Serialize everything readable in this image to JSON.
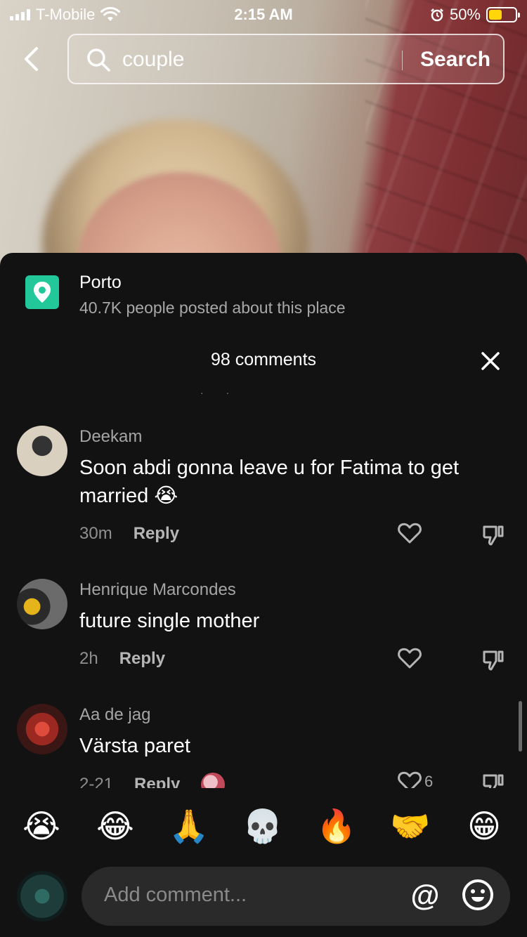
{
  "status_bar": {
    "carrier": "T-Mobile",
    "time": "2:15 AM",
    "battery_percent": "50%",
    "battery_level": 0.5,
    "battery_color": "#ffd60a"
  },
  "search": {
    "query": "couple",
    "button_label": "Search"
  },
  "place": {
    "name": "Porto",
    "subtitle": "40.7K people posted about this place",
    "icon": "location-pin-icon",
    "icon_color": "#22c79a"
  },
  "comments_header": {
    "title": "98 comments"
  },
  "comments": [
    {
      "username": "Deekam",
      "text": "Soon abdi gonna leave u for Fatima to get married 😭",
      "time": "30m",
      "reply_label": "Reply",
      "likes": ""
    },
    {
      "username": "Henrique Marcondes",
      "text": "future single mother",
      "time": "2h",
      "reply_label": "Reply",
      "likes": ""
    },
    {
      "username": "Aa de jag",
      "text": "Värsta paret",
      "time": "2-21",
      "reply_label": "Reply",
      "likes": "6"
    }
  ],
  "emoji_bar": [
    "😭",
    "😂",
    "🙏",
    "💀",
    "🔥",
    "🤝",
    "😁"
  ],
  "input": {
    "placeholder": "Add comment...",
    "mention_symbol": "@"
  }
}
